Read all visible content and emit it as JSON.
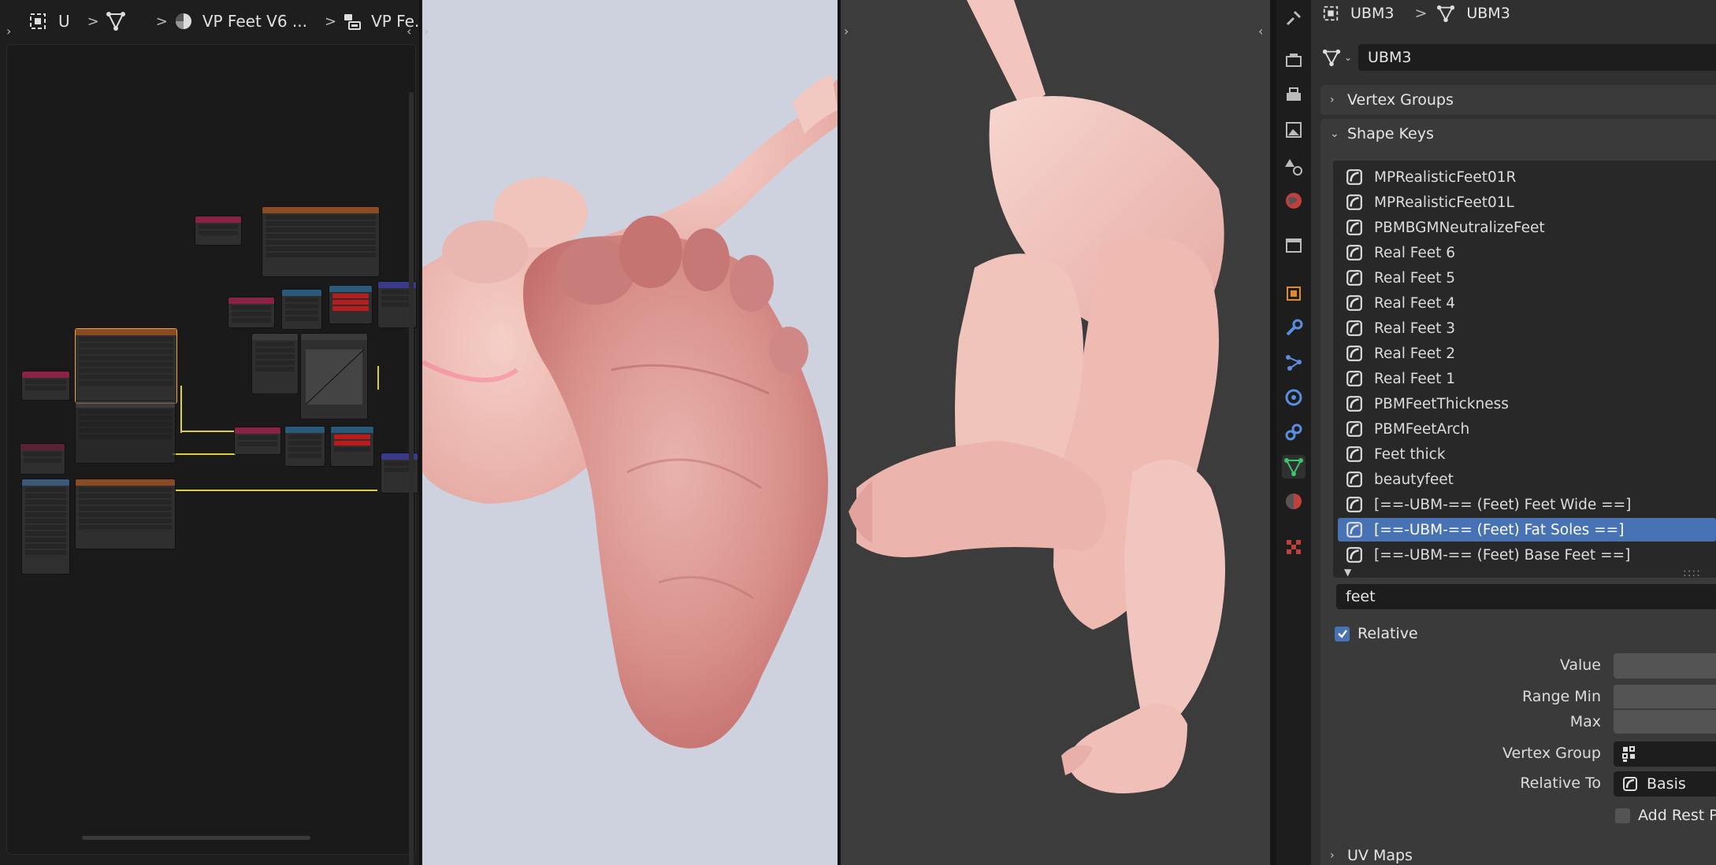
{
  "node_editor": {
    "breadcrumb": [
      {
        "icon": "object-icon",
        "label": "U"
      },
      {
        "icon": "mesh-data-icon",
        "label": ""
      },
      {
        "icon": "material-icon",
        "label": "VP Feet V6 ..."
      },
      {
        "icon": "node-tree-icon",
        "label": "VP Fe..."
      }
    ]
  },
  "properties": {
    "breadcrumb": {
      "object": "UBM3",
      "mesh": "UBM3"
    },
    "mesh_name": "UBM3",
    "vertex_groups_title": "Vertex Groups",
    "shape_keys_title": "Shape Keys",
    "shape_keys": [
      "MPRealisticFeet01R",
      "MPRealisticFeet01L",
      "PBMBGMNeutralizeFeet",
      "Real Feet 6",
      "Real Feet 5",
      "Real Feet 4",
      "Real Feet 3",
      "Real Feet 2",
      "Real Feet 1",
      "PBMFeetThickness",
      "PBMFeetArch",
      "Feet thick",
      "beautyfeet",
      "[==-UBM-== (Feet) Feet Wide ==]",
      "[==-UBM-== (Feet) Fat Soles ==]",
      "[==-UBM-== (Feet) Base Feet ==]"
    ],
    "active_shape_key_index": 14,
    "filter_text": "feet",
    "relative_label": "Relative",
    "relative_checked": true,
    "value_label": "Value",
    "range_min_label": "Range Min",
    "max_label": "Max",
    "vertex_group_label": "Vertex Group",
    "relative_to_label": "Relative To",
    "relative_to_value": "Basis",
    "add_rest_label": "Add Rest Po",
    "uv_maps_title": "UV Maps",
    "list_grip": "::::"
  },
  "colors": {
    "accent": "#4772b3",
    "panel_bg": "#303030",
    "viewport_left_bg": "#ced1de",
    "viewport_right_bg": "#3c3c3c"
  }
}
